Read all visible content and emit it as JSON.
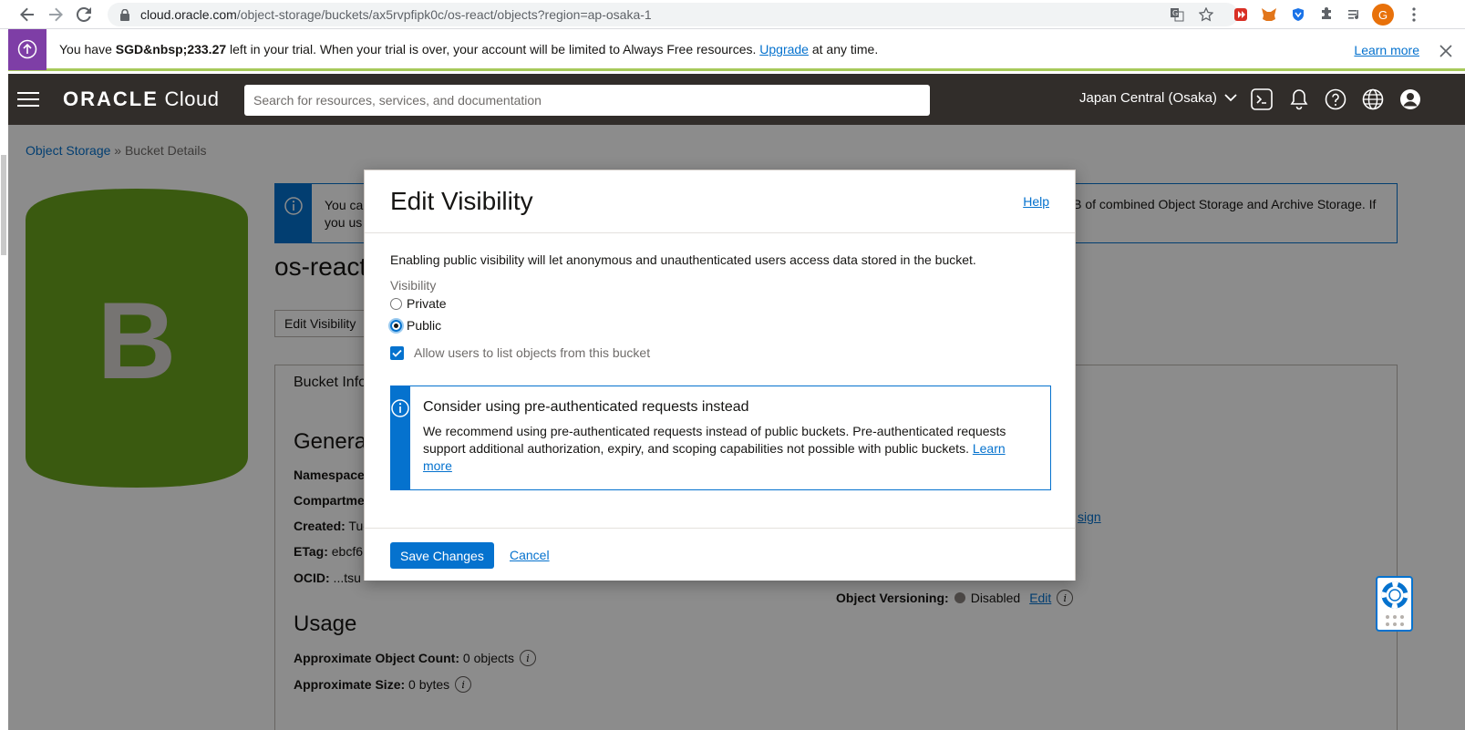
{
  "browser": {
    "url_host": "cloud.oracle.com",
    "url_path": "/object-storage/buckets/ax5rvpfipk0c/os-react/objects?region=ap-osaka-1",
    "profile_initial": "G"
  },
  "trial_banner": {
    "prefix": "You have ",
    "amount": "SGD&nbsp;233.27",
    "middle": " left in your trial. When your trial is over, your account will be limited to Always Free resources. ",
    "upgrade_link": "Upgrade",
    "suffix": " at any time.",
    "learn_more": "Learn more"
  },
  "header": {
    "logo_oracle": "ORACLE",
    "logo_cloud": " Cloud",
    "search_placeholder": "Search for resources, services, and documentation",
    "region": "Japan Central (Osaka)"
  },
  "page": {
    "breadcrumb_link": "Object Storage",
    "breadcrumb_sep": " » ",
    "breadcrumb_current": "Bucket Details",
    "bucket_letter": "B",
    "banner_text_a": "You ca",
    "banner_text_b": "you us",
    "banner_text_right": "iB of combined Object Storage and Archive Storage. If",
    "bucket_name": "os-react",
    "edit_visibility_btn": "Edit Visibility",
    "tab_bucket_info": "Bucket Info",
    "general_heading": "Genera",
    "f_namespace": "Namespace",
    "f_compartment": "Compartme",
    "f_created": "Created:",
    "f_created_val": " Tue",
    "f_etag": "ETag:",
    "f_etag_val": " ebcf6",
    "f_ocid": "OCID:",
    "f_ocid_val": " ...tsu",
    "usage_heading": "Usage",
    "f_obj_count": "Approximate Object Count:",
    "f_obj_count_val": " 0 objects",
    "f_size": "Approximate Size:",
    "f_size_val": " 0 bytes",
    "ov_label": "Object Versioning:",
    "ov_value": "Disabled",
    "ov_edit": "Edit",
    "assign_fragment": "sign"
  },
  "modal": {
    "title": "Edit Visibility",
    "help": "Help",
    "description": "Enabling public visibility will let anonymous and unauthenticated users access data stored in the bucket.",
    "visibility_label": "Visibility",
    "option_private": "Private",
    "option_public": "Public",
    "selected": "Public",
    "allow_list_label": "Allow users to list objects from this bucket",
    "allow_list_checked": true,
    "par_title": "Consider using pre-authenticated requests instead",
    "par_text": "We recommend using pre-authenticated requests instead of public buckets. Pre-authenticated requests support additional authorization, expiry, and scoping capabilities not possible with public buckets. ",
    "par_link": "Learn more",
    "save": "Save Changes",
    "cancel": "Cancel"
  },
  "colors": {
    "accent": "#0572ce",
    "header_bg": "#312d2a",
    "trial_icon_bg": "#7e3ea6",
    "bucket_logo": "#6aa41e"
  }
}
